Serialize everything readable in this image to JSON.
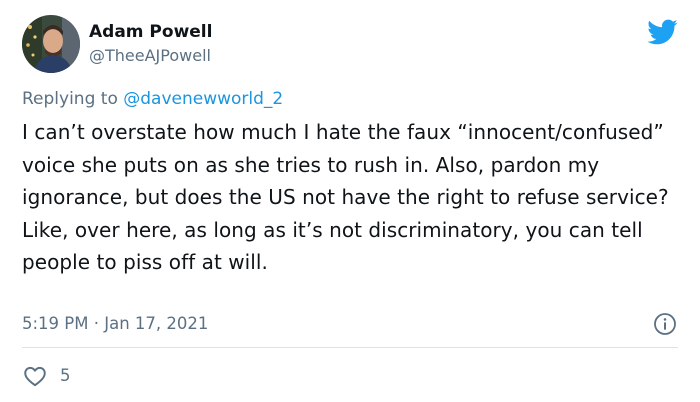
{
  "author": {
    "name": "Adam Powell",
    "handle": "@TheeAJPowell"
  },
  "reply": {
    "prefix": "Replying to ",
    "mention": "@davenewworld_2"
  },
  "tweet": {
    "text": "I can’t overstate how much I hate the faux “innocent/confused” voice she puts on as she tries to rush in. Also, pardon my ignorance, but does the US not have the right to refuse service? Like, over here, as long as it’s not discriminatory, you can tell people to piss off at will.",
    "timestamp": "5:19 PM · Jan 17, 2021"
  },
  "actions": {
    "like_count": "5"
  },
  "icons": {
    "brand": "twitter-bird-icon",
    "info": "info-icon",
    "like": "heart-icon"
  },
  "colors": {
    "brand": "#1da1f2",
    "link": "#1b95e0",
    "secondary_text": "#5b7083",
    "primary_text": "#0f1419",
    "divider": "#dbe2e8"
  }
}
